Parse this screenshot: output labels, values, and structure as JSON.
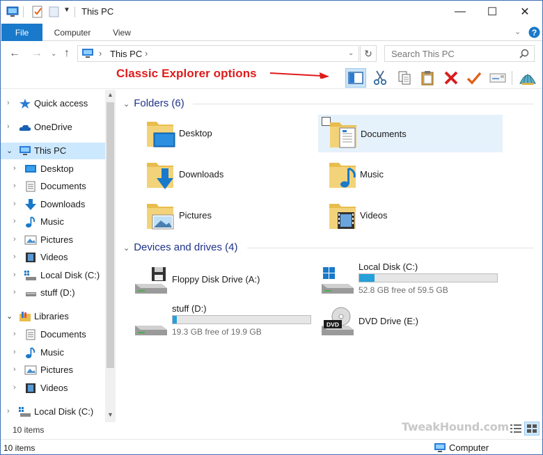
{
  "window": {
    "title": "This PC",
    "minimize": "—",
    "maximize": "☐",
    "close": "✕"
  },
  "ribbon": {
    "tabs": [
      "File",
      "Computer",
      "View"
    ]
  },
  "address": {
    "path": "This PC",
    "separator": "›",
    "search_placeholder": "Search This PC"
  },
  "annotation": "Classic Explorer options",
  "nav": {
    "items": [
      {
        "label": "Quick access"
      },
      {
        "label": "OneDrive"
      },
      {
        "label": "This PC"
      },
      {
        "label": "Desktop"
      },
      {
        "label": "Documents"
      },
      {
        "label": "Downloads"
      },
      {
        "label": "Music"
      },
      {
        "label": "Pictures"
      },
      {
        "label": "Videos"
      },
      {
        "label": "Local Disk (C:)"
      },
      {
        "label": "stuff (D:)"
      },
      {
        "label": "Libraries"
      },
      {
        "label": "Documents"
      },
      {
        "label": "Music"
      },
      {
        "label": "Pictures"
      },
      {
        "label": "Videos"
      },
      {
        "label": "Local Disk (C:)"
      }
    ],
    "count": "10 items"
  },
  "content": {
    "folders_header": "Folders (6)",
    "folders": [
      {
        "label": "Desktop"
      },
      {
        "label": "Documents"
      },
      {
        "label": "Downloads"
      },
      {
        "label": "Music"
      },
      {
        "label": "Pictures"
      },
      {
        "label": "Videos"
      }
    ],
    "devices_header": "Devices and drives (4)",
    "drives": [
      {
        "label": "Floppy Disk Drive (A:)"
      },
      {
        "label": "Local Disk (C:)",
        "free": "52.8 GB free of 59.5 GB",
        "used_fraction": 0.11
      },
      {
        "label": "stuff (D:)",
        "free": "19.3 GB free of 19.9 GB",
        "used_fraction": 0.03
      },
      {
        "label": "DVD Drive (E:)",
        "badge": "DVD"
      }
    ]
  },
  "watermark": "TweakHound.com",
  "status": {
    "count": "10 items",
    "location": "Computer"
  },
  "colors": {
    "accent": "#1979ca",
    "selection": "#cce8ff",
    "drive_fill": "#26a0da",
    "annotation": "#e01b1b"
  }
}
